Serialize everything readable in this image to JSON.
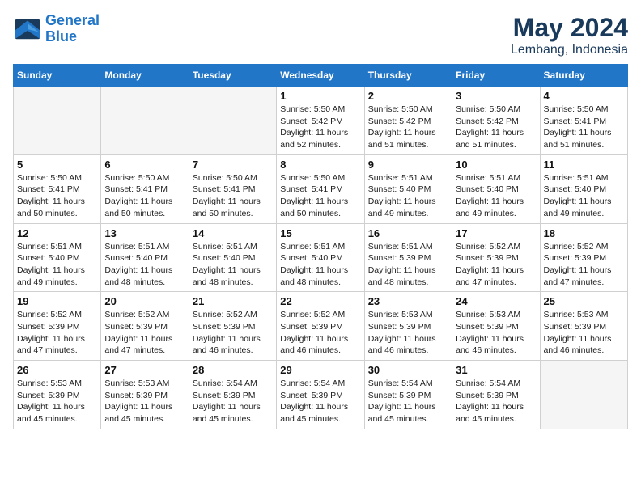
{
  "header": {
    "logo_line1": "General",
    "logo_line2": "Blue",
    "month": "May 2024",
    "location": "Lembang, Indonesia"
  },
  "weekdays": [
    "Sunday",
    "Monday",
    "Tuesday",
    "Wednesday",
    "Thursday",
    "Friday",
    "Saturday"
  ],
  "weeks": [
    [
      {
        "day": "",
        "info": ""
      },
      {
        "day": "",
        "info": ""
      },
      {
        "day": "",
        "info": ""
      },
      {
        "day": "1",
        "info": "Sunrise: 5:50 AM\nSunset: 5:42 PM\nDaylight: 11 hours and 52 minutes."
      },
      {
        "day": "2",
        "info": "Sunrise: 5:50 AM\nSunset: 5:42 PM\nDaylight: 11 hours and 51 minutes."
      },
      {
        "day": "3",
        "info": "Sunrise: 5:50 AM\nSunset: 5:42 PM\nDaylight: 11 hours and 51 minutes."
      },
      {
        "day": "4",
        "info": "Sunrise: 5:50 AM\nSunset: 5:41 PM\nDaylight: 11 hours and 51 minutes."
      }
    ],
    [
      {
        "day": "5",
        "info": "Sunrise: 5:50 AM\nSunset: 5:41 PM\nDaylight: 11 hours and 50 minutes."
      },
      {
        "day": "6",
        "info": "Sunrise: 5:50 AM\nSunset: 5:41 PM\nDaylight: 11 hours and 50 minutes."
      },
      {
        "day": "7",
        "info": "Sunrise: 5:50 AM\nSunset: 5:41 PM\nDaylight: 11 hours and 50 minutes."
      },
      {
        "day": "8",
        "info": "Sunrise: 5:50 AM\nSunset: 5:41 PM\nDaylight: 11 hours and 50 minutes."
      },
      {
        "day": "9",
        "info": "Sunrise: 5:51 AM\nSunset: 5:40 PM\nDaylight: 11 hours and 49 minutes."
      },
      {
        "day": "10",
        "info": "Sunrise: 5:51 AM\nSunset: 5:40 PM\nDaylight: 11 hours and 49 minutes."
      },
      {
        "day": "11",
        "info": "Sunrise: 5:51 AM\nSunset: 5:40 PM\nDaylight: 11 hours and 49 minutes."
      }
    ],
    [
      {
        "day": "12",
        "info": "Sunrise: 5:51 AM\nSunset: 5:40 PM\nDaylight: 11 hours and 49 minutes."
      },
      {
        "day": "13",
        "info": "Sunrise: 5:51 AM\nSunset: 5:40 PM\nDaylight: 11 hours and 48 minutes."
      },
      {
        "day": "14",
        "info": "Sunrise: 5:51 AM\nSunset: 5:40 PM\nDaylight: 11 hours and 48 minutes."
      },
      {
        "day": "15",
        "info": "Sunrise: 5:51 AM\nSunset: 5:40 PM\nDaylight: 11 hours and 48 minutes."
      },
      {
        "day": "16",
        "info": "Sunrise: 5:51 AM\nSunset: 5:39 PM\nDaylight: 11 hours and 48 minutes."
      },
      {
        "day": "17",
        "info": "Sunrise: 5:52 AM\nSunset: 5:39 PM\nDaylight: 11 hours and 47 minutes."
      },
      {
        "day": "18",
        "info": "Sunrise: 5:52 AM\nSunset: 5:39 PM\nDaylight: 11 hours and 47 minutes."
      }
    ],
    [
      {
        "day": "19",
        "info": "Sunrise: 5:52 AM\nSunset: 5:39 PM\nDaylight: 11 hours and 47 minutes."
      },
      {
        "day": "20",
        "info": "Sunrise: 5:52 AM\nSunset: 5:39 PM\nDaylight: 11 hours and 47 minutes."
      },
      {
        "day": "21",
        "info": "Sunrise: 5:52 AM\nSunset: 5:39 PM\nDaylight: 11 hours and 46 minutes."
      },
      {
        "day": "22",
        "info": "Sunrise: 5:52 AM\nSunset: 5:39 PM\nDaylight: 11 hours and 46 minutes."
      },
      {
        "day": "23",
        "info": "Sunrise: 5:53 AM\nSunset: 5:39 PM\nDaylight: 11 hours and 46 minutes."
      },
      {
        "day": "24",
        "info": "Sunrise: 5:53 AM\nSunset: 5:39 PM\nDaylight: 11 hours and 46 minutes."
      },
      {
        "day": "25",
        "info": "Sunrise: 5:53 AM\nSunset: 5:39 PM\nDaylight: 11 hours and 46 minutes."
      }
    ],
    [
      {
        "day": "26",
        "info": "Sunrise: 5:53 AM\nSunset: 5:39 PM\nDaylight: 11 hours and 45 minutes."
      },
      {
        "day": "27",
        "info": "Sunrise: 5:53 AM\nSunset: 5:39 PM\nDaylight: 11 hours and 45 minutes."
      },
      {
        "day": "28",
        "info": "Sunrise: 5:54 AM\nSunset: 5:39 PM\nDaylight: 11 hours and 45 minutes."
      },
      {
        "day": "29",
        "info": "Sunrise: 5:54 AM\nSunset: 5:39 PM\nDaylight: 11 hours and 45 minutes."
      },
      {
        "day": "30",
        "info": "Sunrise: 5:54 AM\nSunset: 5:39 PM\nDaylight: 11 hours and 45 minutes."
      },
      {
        "day": "31",
        "info": "Sunrise: 5:54 AM\nSunset: 5:39 PM\nDaylight: 11 hours and 45 minutes."
      },
      {
        "day": "",
        "info": ""
      }
    ]
  ]
}
